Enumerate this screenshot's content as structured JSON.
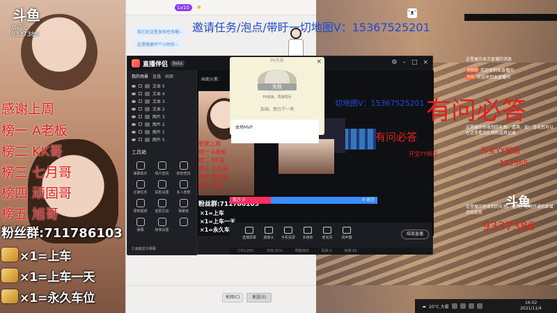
{
  "left_overlay": {
    "logo": "斗鱼",
    "room_label": "房间号",
    "room_id": "9337386",
    "thanks_line": "感谢上周",
    "ranks": [
      "榜一 A老板",
      "榜二 KK哥",
      "榜三 七月哥",
      "榜四 顽固哥",
      "榜五 旭哥"
    ],
    "fans": "粉丝群:711786103",
    "gift_rows": [
      "×1=上车",
      "×1=上车一天",
      "×1=永久车位"
    ]
  },
  "chat_window": {
    "tag": "Lv10",
    "bubble1": "我们在这里发布任务喔~",
    "bubble2": "这里随便开个小时后~",
    "close_label": "关闭(C)",
    "send_label": "发送(S)"
  },
  "banner": {
    "invite_text": "邀请任务/泡点/带盱一切地图V：15367525201"
  },
  "companion": {
    "title": "直播伴侣",
    "badge": "Beta",
    "tabs": [
      "我的场景",
      "直播",
      "画面"
    ],
    "layers": [
      "文本 5",
      "文本 4",
      "文本 3",
      "文本 2",
      "图片 3",
      "图片 2",
      "图片 1",
      "图片 5"
    ],
    "tools_title": "工具箱",
    "tools": [
      "弹幕助手",
      "观众查找",
      "房管查找",
      "主播任务",
      "投影设置",
      "多人连麦",
      "录制视频",
      "连屏互动",
      "弹幕窗",
      "弹幕",
      "帧率设置",
      ""
    ],
    "bottom_check": "3.画面显示弹幕",
    "preview_head": "画面元素：",
    "preview_ranks": [
      "感谢上周",
      "榜一 A老板",
      "榜二 KK哥",
      "榜三 七月哥",
      "榜四 顽固哥",
      "榜五 旭哥"
    ],
    "preview_fans": "粉丝群:711786103",
    "preview_gifts": [
      "×1=上车",
      "×1=上车一天",
      "×1=永久车位"
    ],
    "pk_left_label": "我方 0",
    "pk_right_label": "0 对方",
    "toolbar": [
      "直播屏幕",
      "摄像头",
      "手机投屏",
      "多媒体",
      "麦克风",
      "扬声器"
    ],
    "stop_label": "结束直播",
    "status": [
      "CPU:29%",
      "内存:25%",
      "网络良好",
      "码率:0",
      "帧率:60"
    ]
  },
  "pk_popup": {
    "title": "PK失败",
    "ribbon": "失败",
    "desc": "PK结束，再接再厉",
    "next": "加油，努力下一场",
    "mvp": "本场MVP"
  },
  "right_overlay": {
    "intro": "这里展示本次直播的消息",
    "msgs": [
      {
        "badge": "新粉丝",
        "text": "欢迎来到本直播间"
      },
      {
        "badge": "头衔",
        "text": "欢迎来到本直播间"
      }
    ],
    "gift_tip": "这里展示你收到的礼物、道具，如：连击后可以在这里看到礼物和道具记录",
    "big_text": "有问必答",
    "kaiqi": "开宝YY频道",
    "num1": "182365",
    "logo": "斗鱼",
    "gift_tip2": "这里展示你收到的礼物、道具，礼物开通后即显示在此处",
    "num2": "9337386",
    "mid_text": "有问必答",
    "mid_sub": "开宝YY频道",
    "phone": "切地图V：15367525201"
  },
  "taskbar": {
    "weather": "20°C 大雾",
    "time": "16:02",
    "date": "2021/11/4"
  }
}
